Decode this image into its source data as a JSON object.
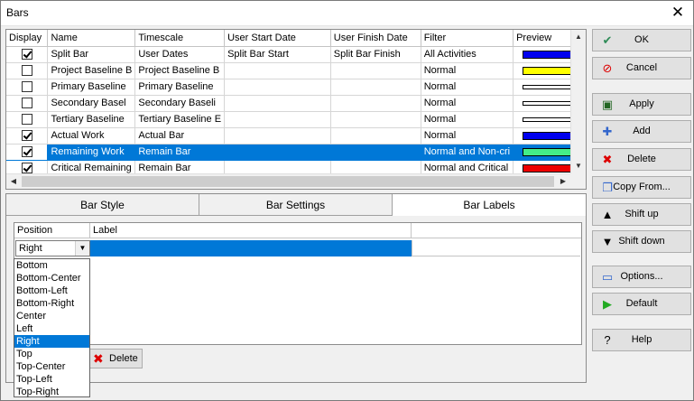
{
  "window": {
    "title": "Bars",
    "close_glyph": "✕"
  },
  "grid": {
    "columns": [
      "Display",
      "Name",
      "Timescale",
      "User Start Date",
      "User Finish Date",
      "Filter",
      "Preview"
    ],
    "rows": [
      {
        "display": true,
        "name": "Split Bar",
        "timescale": "User Dates",
        "start": "Split Bar Start",
        "finish": "Split Bar Finish",
        "filter": "All Activities",
        "preview_color": "#0000ee",
        "preview_style": "solid"
      },
      {
        "display": false,
        "name": "Project Baseline B",
        "timescale": "Project Baseline B",
        "start": "",
        "finish": "",
        "filter": "Normal",
        "preview_color": "#ffff00",
        "preview_style": "solid"
      },
      {
        "display": false,
        "name": "Primary Baseline",
        "timescale": "Primary Baseline",
        "start": "",
        "finish": "",
        "filter": "Normal",
        "preview_color": "#ffffff",
        "preview_style": "line"
      },
      {
        "display": false,
        "name": "Secondary Basel",
        "timescale": "Secondary Baseli",
        "start": "",
        "finish": "",
        "filter": "Normal",
        "preview_color": "#ffffff",
        "preview_style": "line"
      },
      {
        "display": false,
        "name": "Tertiary Baseline",
        "timescale": "Tertiary Baseline E",
        "start": "",
        "finish": "",
        "filter": "Normal",
        "preview_color": "#ffffff",
        "preview_style": "line"
      },
      {
        "display": true,
        "name": "Actual Work",
        "timescale": "Actual Bar",
        "start": "",
        "finish": "",
        "filter": "Normal",
        "preview_color": "#0000ee",
        "preview_style": "solid"
      },
      {
        "display": true,
        "name": "Remaining Work",
        "timescale": "Remain Bar",
        "start": "",
        "finish": "",
        "filter": "Normal and Non-cri",
        "preview_color": "#44ee88",
        "preview_style": "solid",
        "selected": true
      },
      {
        "display": true,
        "name": "Critical Remaining",
        "timescale": "Remain Bar",
        "start": "",
        "finish": "",
        "filter": "Normal and Critical",
        "preview_color": "#ee0000",
        "preview_style": "solid"
      }
    ]
  },
  "tabs": [
    {
      "label": "Bar Style"
    },
    {
      "label": "Bar Settings"
    },
    {
      "label": "Bar Labels",
      "active": true
    }
  ],
  "labels": {
    "col_position": "Position",
    "col_label": "Label",
    "position_value": "Right",
    "options": [
      "Bottom",
      "Bottom-Center",
      "Bottom-Left",
      "Bottom-Right",
      "Center",
      "Left",
      "Right",
      "Top",
      "Top-Center",
      "Top-Left",
      "Top-Right"
    ],
    "highlighted_option": "Right",
    "delete_label": "Delete"
  },
  "buttons": [
    {
      "label": "OK",
      "icon": "check-icon",
      "glyph": "✔",
      "color": "#2e8b57"
    },
    {
      "label": "Cancel",
      "icon": "no-icon",
      "glyph": "⊘",
      "color": "#dd0000"
    },
    {
      "label": "Apply",
      "icon": "apply-icon",
      "glyph": "▣",
      "color": "#226622"
    },
    {
      "label": "Add",
      "icon": "plus-icon",
      "glyph": "✚",
      "color": "#3366cc"
    },
    {
      "label": "Delete",
      "icon": "x-icon",
      "glyph": "✖",
      "color": "#dd0000"
    },
    {
      "label": "Copy From...",
      "icon": "copy-icon",
      "glyph": "❐",
      "color": "#3366cc"
    },
    {
      "label": "Shift up",
      "icon": "triangle-up-icon",
      "glyph": "▲",
      "color": "#000000"
    },
    {
      "label": "Shift down",
      "icon": "triangle-down-icon",
      "glyph": "▼",
      "color": "#000000"
    },
    {
      "label": "Options...",
      "icon": "options-icon",
      "glyph": "▭",
      "color": "#3366cc"
    },
    {
      "label": "Default",
      "icon": "play-icon",
      "glyph": "▶",
      "color": "#22aa22"
    },
    {
      "label": "Help",
      "icon": "help-icon",
      "glyph": "?",
      "color": "#000000"
    }
  ]
}
